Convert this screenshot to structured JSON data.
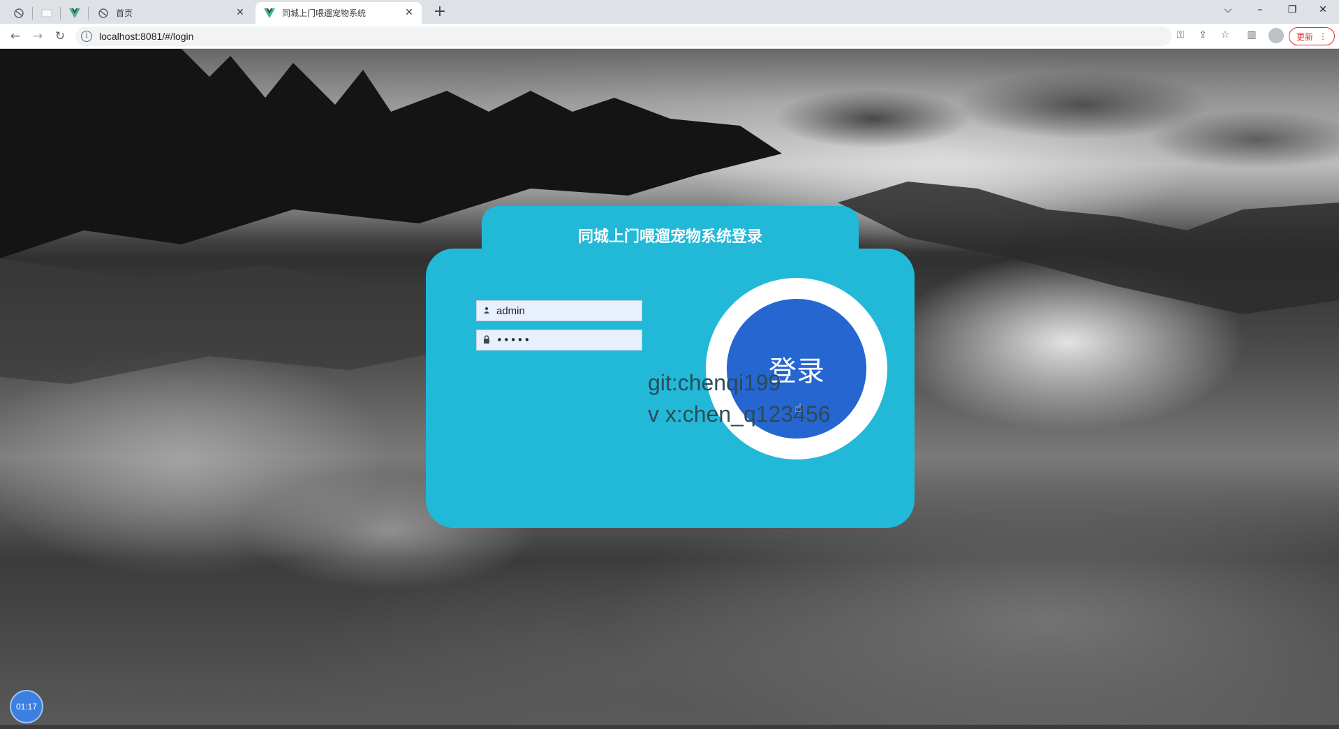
{
  "browser": {
    "tabs": [
      {
        "title": "",
        "pinned": true,
        "icon": "globe-icon"
      },
      {
        "title": "",
        "pinned": true,
        "icon": "page-icon"
      },
      {
        "title": "",
        "pinned": true,
        "icon": "vue-icon"
      },
      {
        "title": "首页",
        "pinned": false,
        "icon": "globe-icon"
      },
      {
        "title": "同城上门喂遛宠物系统",
        "pinned": false,
        "icon": "vue-icon",
        "active": true
      }
    ],
    "url": "localhost:8081/#/login",
    "update_label": "更新",
    "accent_update": "#d93025"
  },
  "login": {
    "title": "同城上门喂遛宠物系统登录",
    "username_value": "admin",
    "password_value": "•••••",
    "button_label": "登录",
    "card_color": "#22b9d9",
    "button_color": "#2566d1"
  },
  "credits": {
    "line1": "git:chenqi199",
    "line2": "v x:chen_q123456"
  },
  "timer": {
    "label": "01:17"
  }
}
